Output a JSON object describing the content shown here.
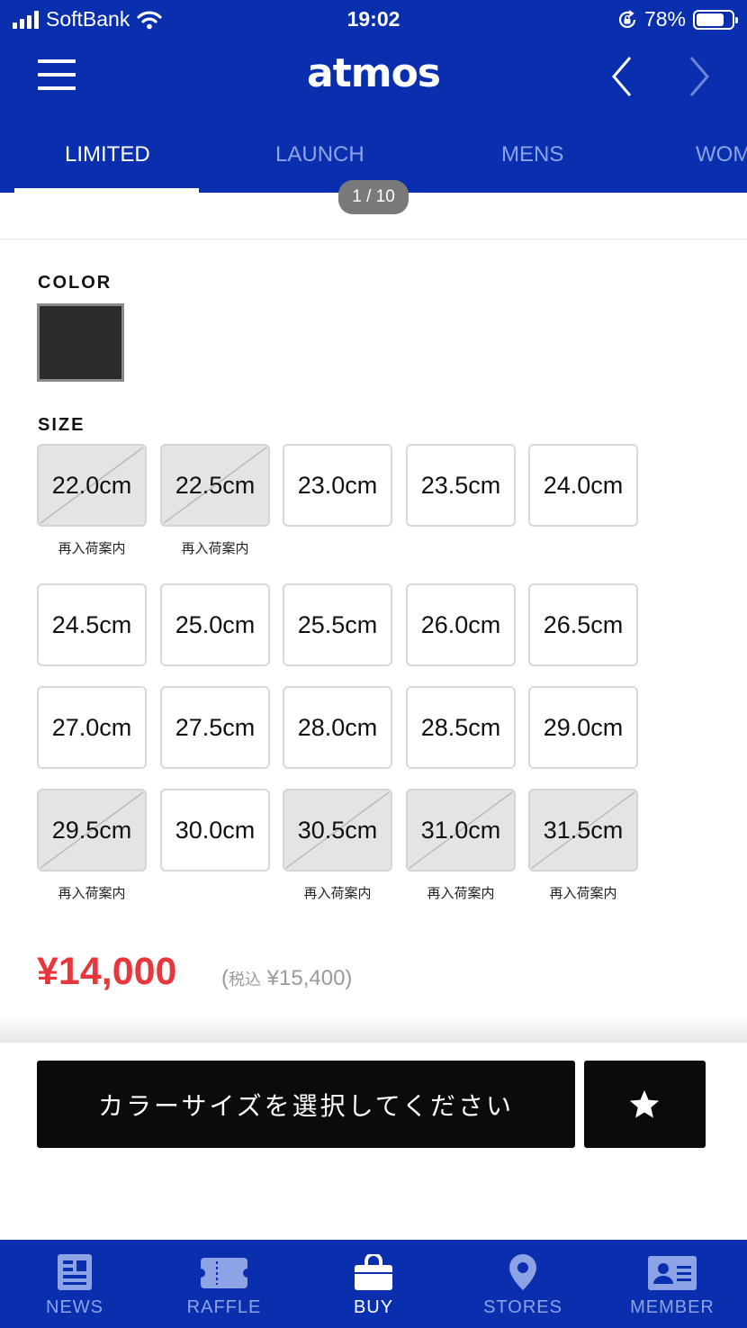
{
  "status_bar": {
    "carrier": "SoftBank",
    "time": "19:02",
    "battery": "78%",
    "battery_level": 0.78
  },
  "header": {
    "logo": "atmos",
    "icons": [
      "menu-icon",
      "back-arrow-icon",
      "forward-arrow-icon"
    ]
  },
  "tabs": [
    {
      "label": "LIMITED",
      "active": true
    },
    {
      "label": "LAUNCH",
      "active": false
    },
    {
      "label": "MENS",
      "active": false
    },
    {
      "label": "WOM",
      "active": false
    }
  ],
  "image_pager": "1 / 10",
  "color_section": {
    "label": "COLOR",
    "swatches": [
      {
        "color": "#2b2b2b",
        "selected": true
      }
    ]
  },
  "size_section": {
    "label": "SIZE",
    "restock_label": "再入荷案内",
    "sizes": [
      {
        "label": "22.0cm",
        "sold_out": true
      },
      {
        "label": "22.5cm",
        "sold_out": true
      },
      {
        "label": "23.0cm",
        "sold_out": false
      },
      {
        "label": "23.5cm",
        "sold_out": false
      },
      {
        "label": "24.0cm",
        "sold_out": false
      },
      {
        "label": "24.5cm",
        "sold_out": false
      },
      {
        "label": "25.0cm",
        "sold_out": false
      },
      {
        "label": "25.5cm",
        "sold_out": false
      },
      {
        "label": "26.0cm",
        "sold_out": false
      },
      {
        "label": "26.5cm",
        "sold_out": false
      },
      {
        "label": "27.0cm",
        "sold_out": false
      },
      {
        "label": "27.5cm",
        "sold_out": false
      },
      {
        "label": "28.0cm",
        "sold_out": false
      },
      {
        "label": "28.5cm",
        "sold_out": false
      },
      {
        "label": "29.0cm",
        "sold_out": false
      },
      {
        "label": "29.5cm",
        "sold_out": true
      },
      {
        "label": "30.0cm",
        "sold_out": false
      },
      {
        "label": "30.5cm",
        "sold_out": true
      },
      {
        "label": "31.0cm",
        "sold_out": true
      },
      {
        "label": "31.5cm",
        "sold_out": true
      }
    ]
  },
  "price": {
    "amount": "¥14,000",
    "tax_prefix": "(",
    "tax_label": "税込",
    "tax_amount": " ¥15,400)"
  },
  "actions": {
    "select_prompt": "カラーサイズを選択してください",
    "favorite_icon": "star-icon"
  },
  "bottom_nav": [
    {
      "label": "NEWS",
      "icon": "news-icon",
      "active": false
    },
    {
      "label": "RAFFLE",
      "icon": "ticket-icon",
      "active": false
    },
    {
      "label": "BUY",
      "icon": "shopping-bag-icon",
      "active": true
    },
    {
      "label": "STORES",
      "icon": "location-pin-icon",
      "active": false
    },
    {
      "label": "MEMBER",
      "icon": "member-card-icon",
      "active": false
    }
  ],
  "colors": {
    "brand_blue": "#0a2fae",
    "price_red": "#e8373a",
    "inactive_nav": "#8ea3e6"
  }
}
